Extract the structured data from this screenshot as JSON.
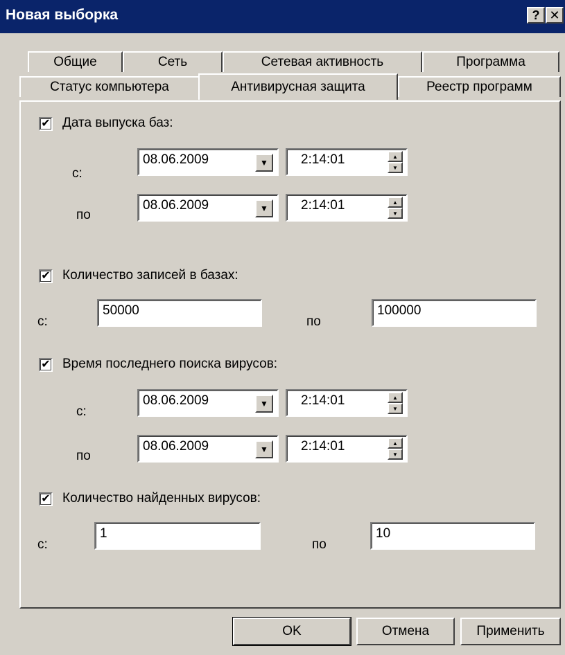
{
  "window": {
    "title": "Новая выборка",
    "help_glyph": "?",
    "close_glyph": "✕"
  },
  "tabs_row1": [
    "Общие",
    "Сеть",
    "Сетевая активность",
    "Программа"
  ],
  "tabs_row2": [
    "Статус компьютера",
    "Антивирусная защита",
    "Реестр программ"
  ],
  "active_tab": "Антивирусная защита",
  "sections": {
    "db_date": {
      "checked": true,
      "label": "Дата выпуска баз:",
      "from_label": "с:",
      "to_label": "по",
      "from_date": "08.06.2009",
      "from_time": "2:14:01",
      "to_date": "08.06.2009",
      "to_time": "2:14:01"
    },
    "db_records": {
      "checked": true,
      "label": "Количество записей в базах:",
      "from_label": "с:",
      "to_label": "по",
      "from_value": "50000",
      "to_value": "100000"
    },
    "last_scan": {
      "checked": true,
      "label": "Время последнего поиска вирусов:",
      "from_label": "с:",
      "to_label": "по",
      "from_date": "08.06.2009",
      "from_time": "2:14:01",
      "to_date": "08.06.2009",
      "to_time": "2:14:01"
    },
    "viruses_found": {
      "checked": true,
      "label": "Количество найденных вирусов:",
      "from_label": "с:",
      "to_label": "по",
      "from_value": "1",
      "to_value": "10"
    }
  },
  "buttons": {
    "ok": "OK",
    "cancel": "Отмена",
    "apply": "Применить"
  },
  "glyphs": {
    "check": "✔",
    "dropdown": "▼",
    "spin_up": "▲",
    "spin_down": "▼"
  },
  "colors": {
    "titlebar": "#0a246a",
    "face": "#d4d0c8"
  }
}
